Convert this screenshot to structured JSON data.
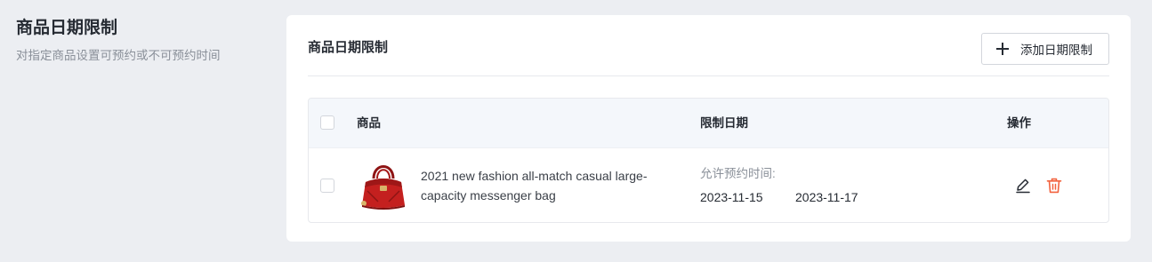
{
  "section": {
    "title": "商品日期限制",
    "description": "对指定商品设置可预约或不可预约时间"
  },
  "card": {
    "title": "商品日期限制",
    "add_button_label": "添加日期限制"
  },
  "table": {
    "columns": {
      "product": "商品",
      "restrict_date": "限制日期",
      "actions": "操作"
    },
    "rows": [
      {
        "product_name": "2021 new fashion all-match casual large-capacity messenger bag",
        "date_label": "允许预约时间:",
        "start_date": "2023-11-15",
        "end_date": "2023-11-17"
      }
    ]
  },
  "colors": {
    "background": "#eceef2",
    "card": "#ffffff",
    "header_row": "#f4f7fb",
    "delete_icon": "#f2623e",
    "product_red": "#c4201f"
  },
  "icons": [
    "plus-icon",
    "edit-icon",
    "trash-icon",
    "handbag-image"
  ]
}
